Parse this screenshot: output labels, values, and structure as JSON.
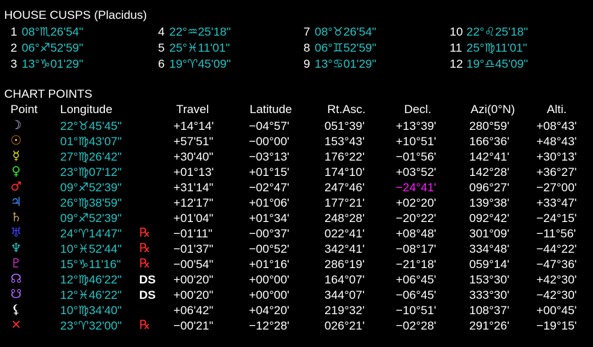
{
  "house_cusps": {
    "title": "HOUSE CUSPS (Placidus)",
    "cusps": [
      {
        "num": "1",
        "value": "08°♏26'54\""
      },
      {
        "num": "2",
        "value": "06°♐52'59\""
      },
      {
        "num": "3",
        "value": "13°♑01'29\""
      },
      {
        "num": "4",
        "value": "22°♒25'18\""
      },
      {
        "num": "5",
        "value": "25°♓11'01\""
      },
      {
        "num": "6",
        "value": "19°♈45'09\""
      },
      {
        "num": "7",
        "value": "08°♉26'54\""
      },
      {
        "num": "8",
        "value": "06°♊52'59\""
      },
      {
        "num": "9",
        "value": "13°♋01'29\""
      },
      {
        "num": "10",
        "value": "22°♌25'18\""
      },
      {
        "num": "11",
        "value": "25°♍11'01\""
      },
      {
        "num": "12",
        "value": "19°♎45'09\""
      }
    ]
  },
  "chart_points": {
    "title": "CHART POINTS",
    "headers": {
      "point": "Point",
      "longitude": "Longitude",
      "travel": "Travel",
      "latitude": "Latitude",
      "rt_asc": "Rt.Asc.",
      "decl": "Decl.",
      "azi": "Azi(0°N)",
      "alti": "Alti."
    },
    "rows": [
      {
        "icon": "moon-icon",
        "glyph": "☽",
        "color": "#c8c8ff",
        "longitude": "22°♉45'45\"",
        "flag": "",
        "travel": "+14°14'",
        "latitude": "−04°57'",
        "rt_asc": "051°39'",
        "decl": "+13°39'",
        "azi": "280°59'",
        "alti": "+08°43'"
      },
      {
        "icon": "sun-icon",
        "glyph": "☉",
        "color": "#ff9a1a",
        "longitude": "01°♍43'07\"",
        "flag": "",
        "travel": "+57'51\"",
        "latitude": "−00°00'",
        "rt_asc": "153°43'",
        "decl": "+10°51'",
        "azi": "166°36'",
        "alti": "+48°43'"
      },
      {
        "icon": "mercury-icon",
        "glyph": "☿",
        "color": "#e0e000",
        "longitude": "27°♍26'42\"",
        "flag": "",
        "travel": "+30'40\"",
        "latitude": "−03°13'",
        "rt_asc": "176°22'",
        "decl": "−01°56'",
        "azi": "142°41'",
        "alti": "+30°13'"
      },
      {
        "icon": "venus-icon",
        "glyph": "♀",
        "color": "#33dd33",
        "longitude": "23°♍07'12\"",
        "flag": "",
        "travel": "+01°13'",
        "latitude": "+01°15'",
        "rt_asc": "174°10'",
        "decl": "+03°52'",
        "azi": "142°28'",
        "alti": "+36°27'"
      },
      {
        "icon": "mars-icon",
        "glyph": "♂",
        "color": "#ff2a2a",
        "longitude": "09°♐52'39\"",
        "flag": "",
        "travel": "+31'14\"",
        "latitude": "−02°47'",
        "rt_asc": "247°46'",
        "decl": "−24°41'",
        "decl_highlight": true,
        "azi": "096°27'",
        "alti": "−27°00'"
      },
      {
        "icon": "jupiter-icon",
        "glyph": "♃",
        "color": "#3a8cff",
        "longitude": "26°♍38'59\"",
        "flag": "",
        "travel": "+12'17\"",
        "latitude": "+01°06'",
        "rt_asc": "177°21'",
        "decl": "+02°20'",
        "azi": "139°38'",
        "alti": "+33°47'"
      },
      {
        "icon": "saturn-icon",
        "glyph": "♄",
        "color": "#c8a060",
        "longitude": "09°♐52'39\"",
        "flag": "",
        "travel": "+01'04\"",
        "latitude": "+01°34'",
        "rt_asc": "248°28'",
        "decl": "−20°22'",
        "azi": "092°42'",
        "alti": "−24°15'"
      },
      {
        "icon": "uranus-icon",
        "glyph": "♅",
        "color": "#4040ff",
        "longitude": "24°♈14'47\"",
        "flag": "℞",
        "travel": "−01'11\"",
        "latitude": "−00°37'",
        "rt_asc": "022°41'",
        "decl": "+08°48'",
        "azi": "301°09'",
        "alti": "−11°56'"
      },
      {
        "icon": "neptune-icon",
        "glyph": "♆",
        "color": "#22c5c5",
        "longitude": "10°♓52'44\"",
        "flag": "℞",
        "travel": "−01'37\"",
        "latitude": "−00°52'",
        "rt_asc": "342°41'",
        "decl": "−08°17'",
        "azi": "334°48'",
        "alti": "−44°22'"
      },
      {
        "icon": "pluto-icon",
        "glyph": "♇",
        "color": "#cc33cc",
        "longitude": "15°♑11'16\"",
        "flag": "℞",
        "travel": "−00'54\"",
        "latitude": "+01°16'",
        "rt_asc": "286°19'",
        "decl": "−21°18'",
        "azi": "059°14'",
        "alti": "−47°36'"
      },
      {
        "icon": "north-node-icon",
        "glyph": "☊",
        "color": "#b060ff",
        "longitude": "12°♍46'22\"",
        "flag": "DS",
        "travel": "+00'20\"",
        "latitude": "+00°00'",
        "rt_asc": "164°07'",
        "decl": "+06°45'",
        "azi": "153°30'",
        "alti": "+42°30'"
      },
      {
        "icon": "south-node-icon",
        "glyph": "☋",
        "color": "#b060ff",
        "longitude": "12°♓46'22\"",
        "flag": "DS",
        "travel": "+00'20\"",
        "latitude": "+00°00'",
        "rt_asc": "344°07'",
        "decl": "−06°45'",
        "azi": "333°30'",
        "alti": "−42°30'"
      },
      {
        "icon": "lilith-icon",
        "glyph": "⚸",
        "color": "#ffffff",
        "longitude": "10°♍34'40\"",
        "flag": "",
        "travel": "+06'42\"",
        "latitude": "+04°20'",
        "rt_asc": "219°32'",
        "decl": "−10°51'",
        "azi": "108°37'",
        "alti": "+00°45'"
      },
      {
        "icon": "vertex-icon",
        "glyph": "✕",
        "color": "#ff2a2a",
        "longitude": "23°♈32'00\"",
        "flag": "℞",
        "travel": "−00'21\"",
        "latitude": "−12°28'",
        "rt_asc": "026°21'",
        "decl": "−02°28'",
        "azi": "291°26'",
        "alti": "−19°15'"
      }
    ]
  },
  "colors": {
    "background": "#000000",
    "text": "#ffffff",
    "value": "#22c5c5",
    "highlight": "#ff1aff",
    "retrograde": "#ff2a2a"
  }
}
